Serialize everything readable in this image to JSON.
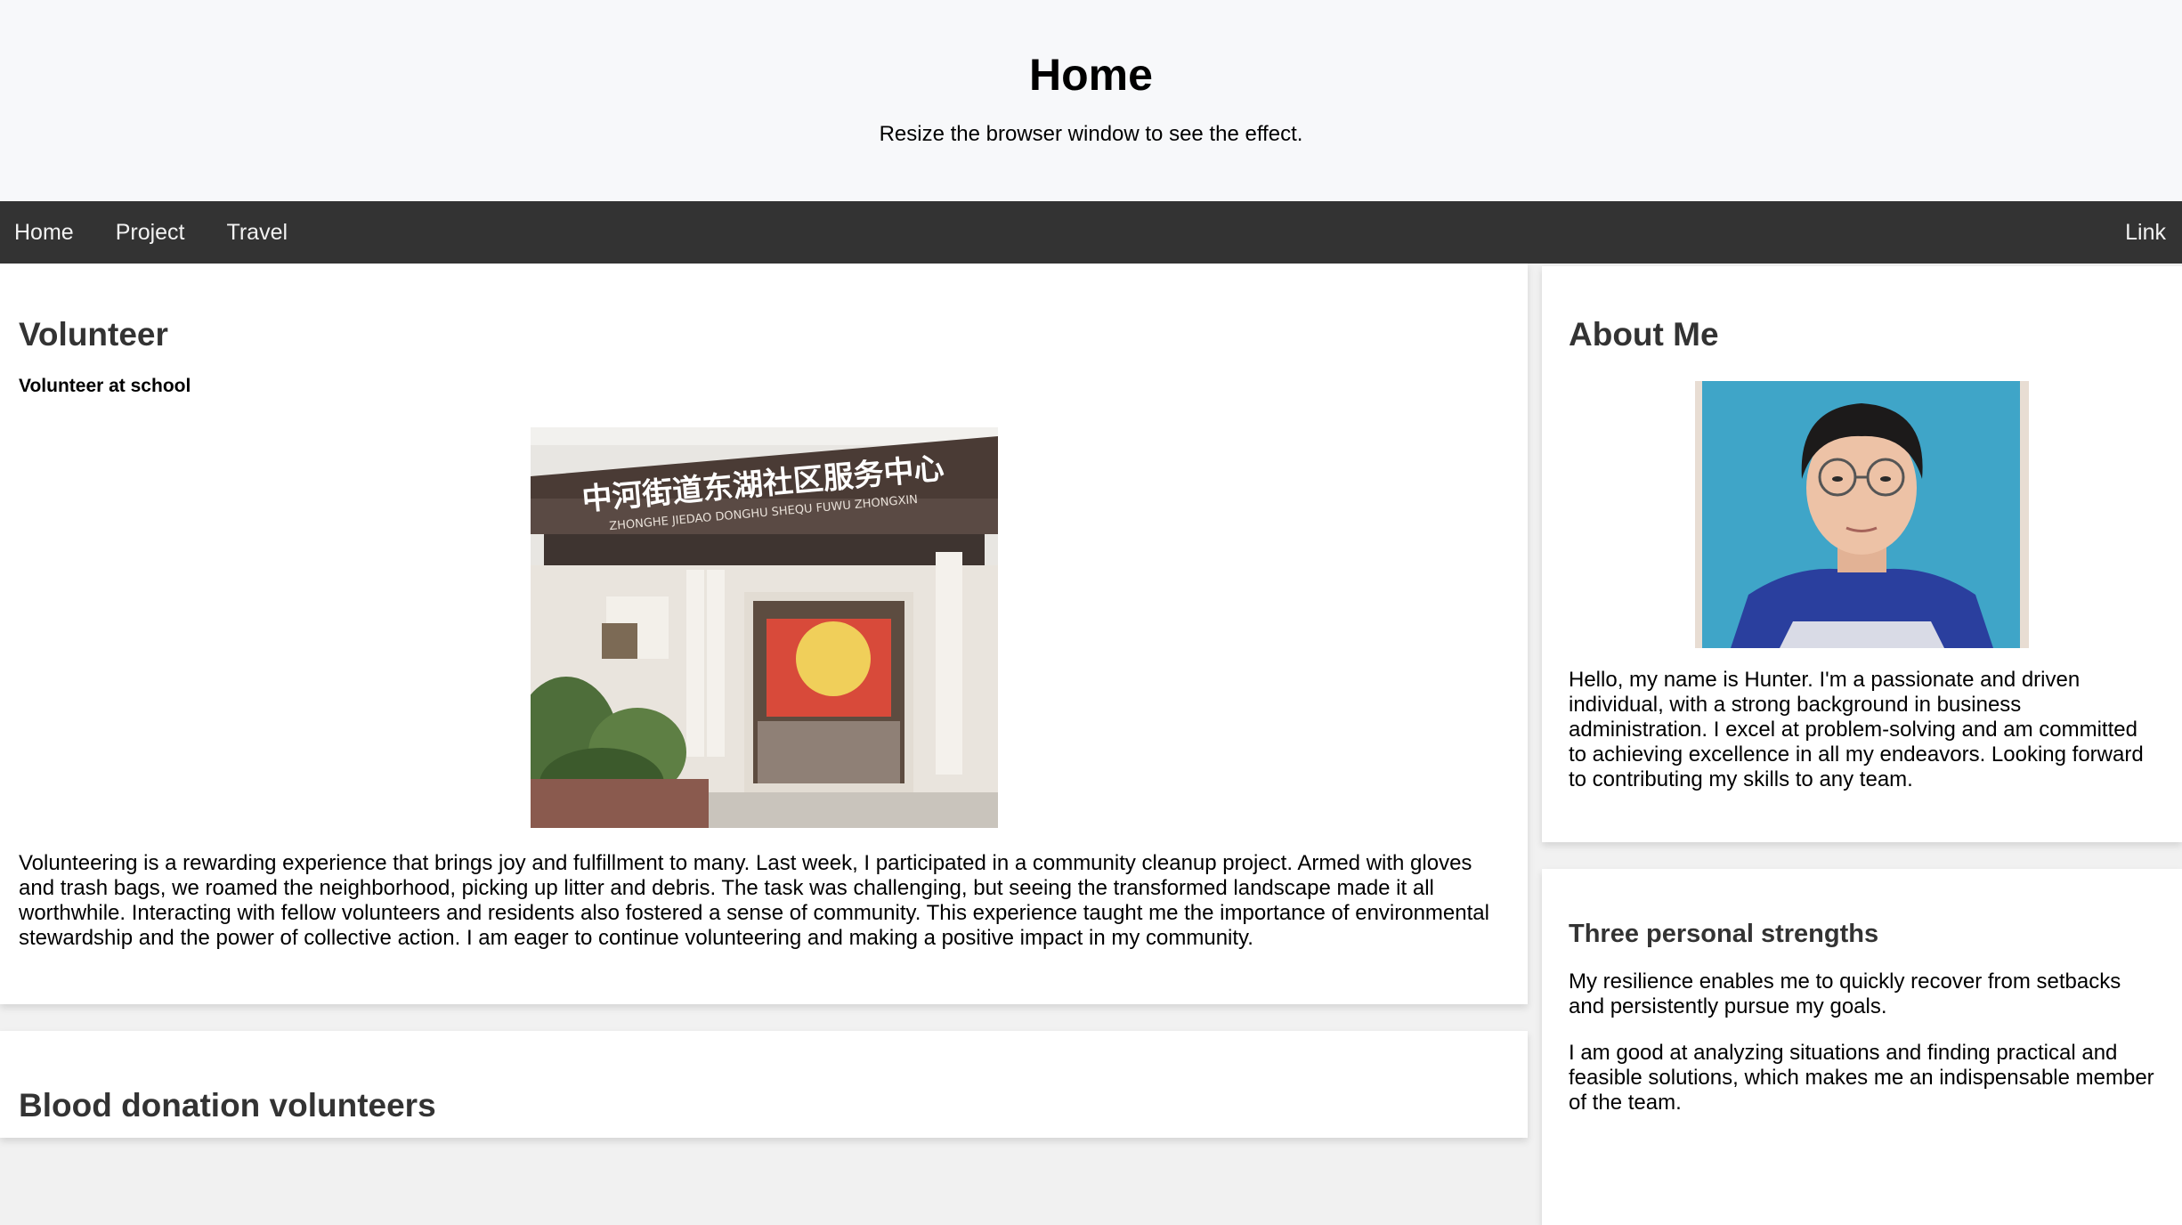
{
  "header": {
    "title": "Home",
    "subtitle": "Resize the browser window to see the effect."
  },
  "nav": {
    "items": [
      "Home",
      "Project",
      "Travel"
    ],
    "right": "Link"
  },
  "volunteer": {
    "title": "Volunteer",
    "subtitle": "Volunteer at school",
    "sign_cn": "中河街道东湖社区服务中心",
    "sign_pinyin": "ZHONGHE JIEDAO DONGHU SHEQU FUWU ZHONGXIN",
    "text": "Volunteering is a rewarding experience that brings joy and fulfillment to many. Last week, I participated in a community cleanup project. Armed with gloves and trash bags, we roamed the neighborhood, picking up litter and debris. The task was challenging, but seeing the transformed landscape made it all worthwhile. Interacting with fellow volunteers and residents also fostered a sense of community. This experience taught me the importance of environmental stewardship and the power of collective action. I am eager to continue volunteering and making a positive impact in my community."
  },
  "blood": {
    "title": "Blood donation volunteers"
  },
  "about": {
    "title": "About Me",
    "text": "Hello, my name is Hunter. I'm a passionate and driven individual, with a strong background in business administration. I excel at problem-solving and am committed to achieving excellence in all my endeavors. Looking forward to contributing my skills to any team."
  },
  "strengths": {
    "title": "Three personal strengths",
    "items": [
      "My resilience enables me to quickly recover from setbacks and persistently pursue my goals.",
      "I am good at analyzing situations and finding practical and feasible solutions, which makes me an indispensable member of the team."
    ]
  }
}
